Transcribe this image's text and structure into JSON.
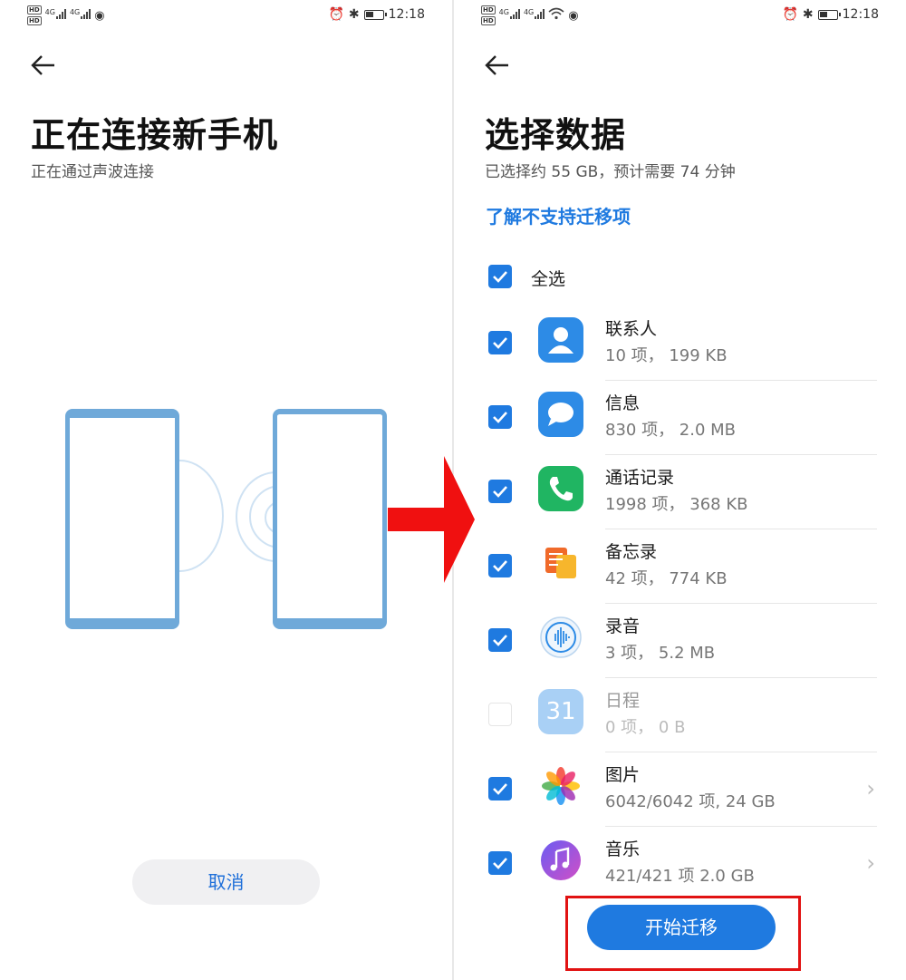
{
  "status_bar": {
    "time": "12:18"
  },
  "left_screen": {
    "back_icon": "arrow-left-icon",
    "title": "正在连接新手机",
    "subtitle": "正在通过声波连接",
    "cancel_label": "取消"
  },
  "right_screen": {
    "back_icon": "arrow-left-icon",
    "title": "选择数据",
    "subtitle": "已选择约 55 GB，预计需要 74 分钟",
    "unsupported_link": "了解不支持迁移项",
    "select_all_label": "全选",
    "items": [
      {
        "name": "联系人",
        "detail": "10 项， 199 KB",
        "checked": true,
        "icon": "contacts-icon"
      },
      {
        "name": "信息",
        "detail": "830 项， 2.0 MB",
        "checked": true,
        "icon": "messages-icon"
      },
      {
        "name": "通话记录",
        "detail": "1998 项， 368 KB",
        "checked": true,
        "icon": "phone-icon"
      },
      {
        "name": "备忘录",
        "detail": "42 项， 774 KB",
        "checked": true,
        "icon": "notes-icon"
      },
      {
        "name": "录音",
        "detail": "3 项， 5.2 MB",
        "checked": true,
        "icon": "recorder-icon"
      },
      {
        "name": "日程",
        "detail": "0 项， 0 B",
        "checked": false,
        "icon": "calendar-icon",
        "icon_text": "31"
      },
      {
        "name": "图片",
        "detail": "6042/6042 项, 24 GB",
        "checked": true,
        "icon": "gallery-icon",
        "has_chevron": true
      },
      {
        "name": "音乐",
        "detail": "421/421 项 2.0 GB",
        "checked": true,
        "icon": "music-icon",
        "has_chevron": true
      }
    ],
    "start_label": "开始迁移"
  },
  "colors": {
    "accent": "#1f7ae0",
    "annotation_red": "#e11212",
    "phone_outline": "#6fa9d9"
  }
}
